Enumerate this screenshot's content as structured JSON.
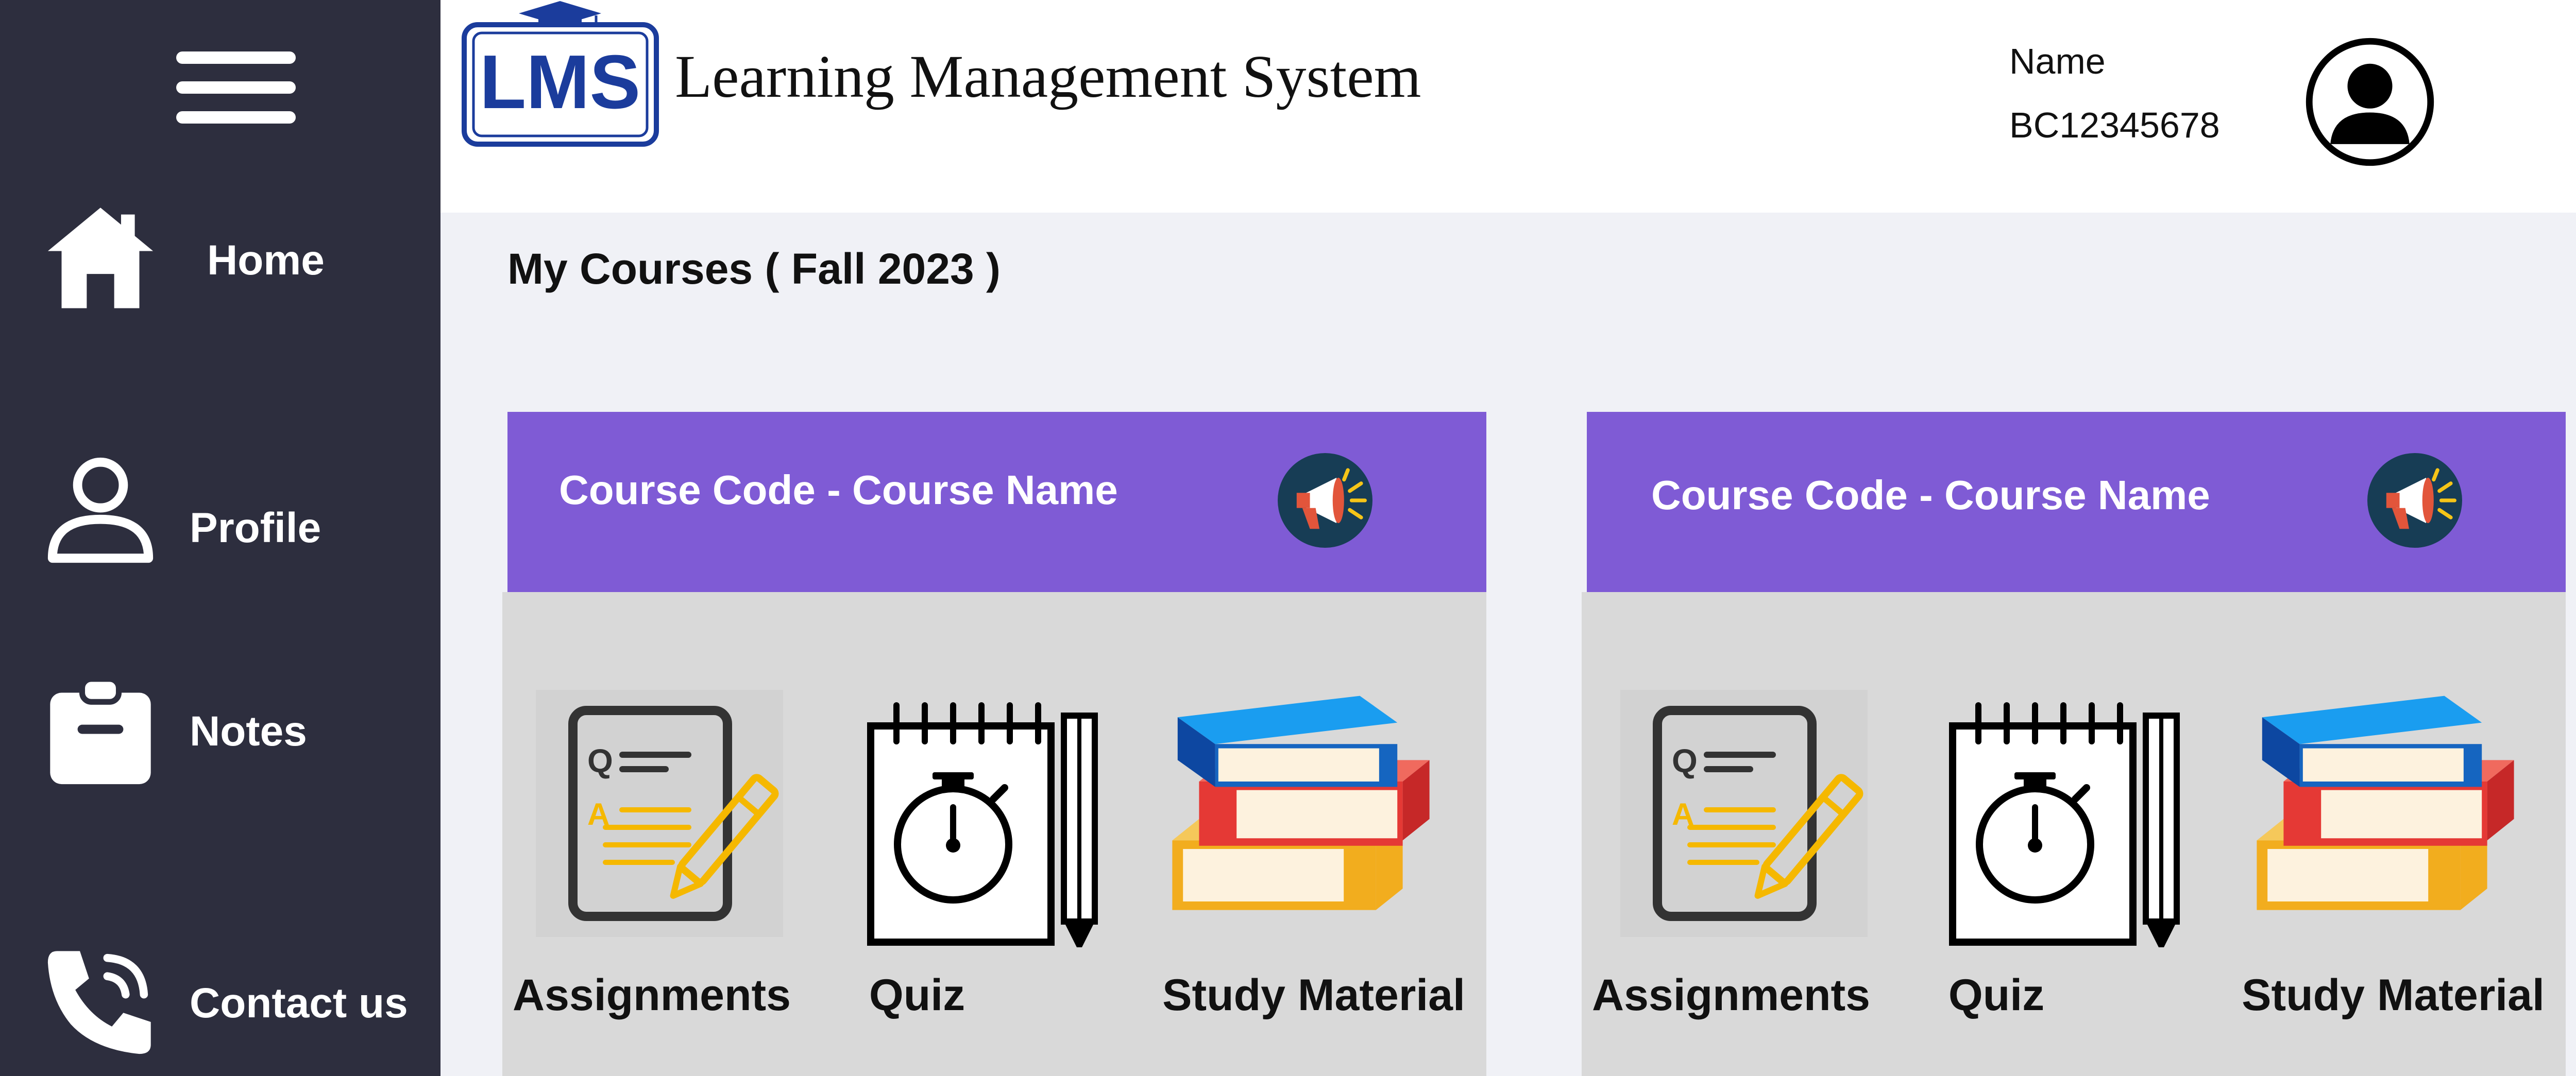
{
  "app": {
    "logo_text": "LMS",
    "title": "Learning Management System"
  },
  "user": {
    "name": "Name",
    "id": "BC12345678"
  },
  "sidebar": {
    "items": [
      {
        "label": "Home",
        "icon": "home-icon"
      },
      {
        "label": "Profile",
        "icon": "user-icon"
      },
      {
        "label": "Notes",
        "icon": "clipboard-icon"
      },
      {
        "label": "Contact us",
        "icon": "phone-icon"
      }
    ]
  },
  "main": {
    "title": "My Courses ( Fall 2023 )",
    "courses": [
      {
        "title": "Course Code - Course Name",
        "tiles": [
          {
            "label": "Assignments",
            "icon": "assignment-icon"
          },
          {
            "label": "Quiz",
            "icon": "quiz-stopwatch-icon"
          },
          {
            "label": "Study Material",
            "icon": "books-icon"
          }
        ]
      },
      {
        "title": "Course Code - Course Name",
        "tiles": [
          {
            "label": "Assignments",
            "icon": "assignment-icon"
          },
          {
            "label": "Quiz",
            "icon": "quiz-stopwatch-icon"
          },
          {
            "label": "Study Material",
            "icon": "books-icon"
          }
        ]
      }
    ]
  },
  "colors": {
    "sidebar": "#2d2e3e",
    "card_header": "#7f5bd5",
    "card_body": "#d9d9d9",
    "background": "#f0f1f6",
    "logo_blue": "#1b3c9c"
  }
}
